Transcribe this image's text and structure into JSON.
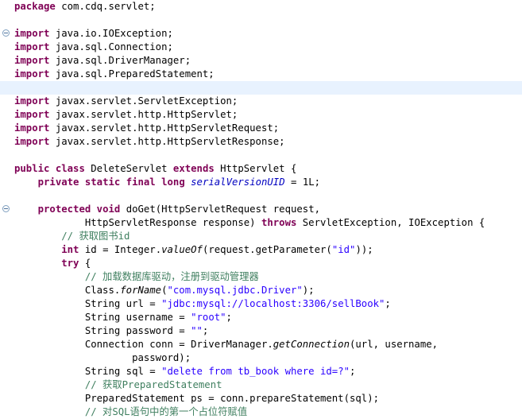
{
  "editor": {
    "lines": [
      [
        {
          "t": "package",
          "s": "kw"
        },
        {
          "t": " com.cdq.servlet;"
        }
      ],
      [],
      [
        {
          "t": "import",
          "s": "kw"
        },
        {
          "t": " java.io.IOException;"
        }
      ],
      [
        {
          "t": "import",
          "s": "kw"
        },
        {
          "t": " java.sql.Connection;"
        }
      ],
      [
        {
          "t": "import",
          "s": "kw"
        },
        {
          "t": " java.sql.DriverManager;"
        }
      ],
      [
        {
          "t": "import",
          "s": "kw"
        },
        {
          "t": " java.sql.PreparedStatement;"
        }
      ],
      [],
      [
        {
          "t": "import",
          "s": "kw"
        },
        {
          "t": " javax.servlet.ServletException;"
        }
      ],
      [
        {
          "t": "import",
          "s": "kw"
        },
        {
          "t": " javax.servlet.http.HttpServlet;"
        }
      ],
      [
        {
          "t": "import",
          "s": "kw"
        },
        {
          "t": " javax.servlet.http.HttpServletRequest;"
        }
      ],
      [
        {
          "t": "import",
          "s": "kw"
        },
        {
          "t": " javax.servlet.http.HttpServletResponse;"
        }
      ],
      [],
      [
        {
          "t": "public",
          "s": "kw"
        },
        {
          "t": " "
        },
        {
          "t": "class",
          "s": "kw"
        },
        {
          "t": " DeleteServlet "
        },
        {
          "t": "extends",
          "s": "kw"
        },
        {
          "t": " HttpServlet {"
        }
      ],
      [
        {
          "t": "    "
        },
        {
          "t": "private",
          "s": "kw"
        },
        {
          "t": " "
        },
        {
          "t": "static",
          "s": "kw"
        },
        {
          "t": " "
        },
        {
          "t": "final",
          "s": "kw"
        },
        {
          "t": " "
        },
        {
          "t": "long",
          "s": "kw"
        },
        {
          "t": " "
        },
        {
          "t": "serialVersionUID",
          "s": "fld"
        },
        {
          "t": " = 1L;"
        }
      ],
      [],
      [
        {
          "t": "    "
        },
        {
          "t": "protected",
          "s": "kw"
        },
        {
          "t": " "
        },
        {
          "t": "void",
          "s": "kw"
        },
        {
          "t": " doGet(HttpServletRequest request,"
        }
      ],
      [
        {
          "t": "            HttpServletResponse response) "
        },
        {
          "t": "throws",
          "s": "kw"
        },
        {
          "t": " ServletException, IOException {"
        }
      ],
      [
        {
          "t": "        "
        },
        {
          "t": "// 获取图书id",
          "s": "cm"
        }
      ],
      [
        {
          "t": "        "
        },
        {
          "t": "int",
          "s": "kw"
        },
        {
          "t": " id = Integer."
        },
        {
          "t": "valueOf",
          "s": "st"
        },
        {
          "t": "(request.getParameter("
        },
        {
          "t": "\"id\"",
          "s": "str"
        },
        {
          "t": "));"
        }
      ],
      [
        {
          "t": "        "
        },
        {
          "t": "try",
          "s": "kw"
        },
        {
          "t": " {"
        }
      ],
      [
        {
          "t": "            "
        },
        {
          "t": "// 加载数据库驱动，注册到驱动管理器",
          "s": "cm"
        }
      ],
      [
        {
          "t": "            Class."
        },
        {
          "t": "forName",
          "s": "st"
        },
        {
          "t": "("
        },
        {
          "t": "\"com.mysql.jdbc.Driver\"",
          "s": "str"
        },
        {
          "t": ");"
        }
      ],
      [
        {
          "t": "            String url = "
        },
        {
          "t": "\"jdbc:mysql://localhost:3306/sellBook\"",
          "s": "str"
        },
        {
          "t": ";"
        }
      ],
      [
        {
          "t": "            String username = "
        },
        {
          "t": "\"root\"",
          "s": "str"
        },
        {
          "t": ";"
        }
      ],
      [
        {
          "t": "            String password = "
        },
        {
          "t": "\"\"",
          "s": "str"
        },
        {
          "t": ";"
        }
      ],
      [
        {
          "t": "            Connection conn = DriverManager."
        },
        {
          "t": "getConnection",
          "s": "st"
        },
        {
          "t": "(url, username,"
        }
      ],
      [
        {
          "t": "                    password);"
        }
      ],
      [
        {
          "t": "            String sql = "
        },
        {
          "t": "\"delete from tb_book where id=?\"",
          "s": "str"
        },
        {
          "t": ";"
        }
      ],
      [
        {
          "t": "            "
        },
        {
          "t": "// 获取PreparedStatement",
          "s": "cm"
        }
      ],
      [
        {
          "t": "            PreparedStatement ps = conn.prepareStatement(sql);"
        }
      ],
      [
        {
          "t": "            "
        },
        {
          "t": "// 对SQL语句中的第一个占位符赋值",
          "s": "cm"
        }
      ]
    ]
  }
}
